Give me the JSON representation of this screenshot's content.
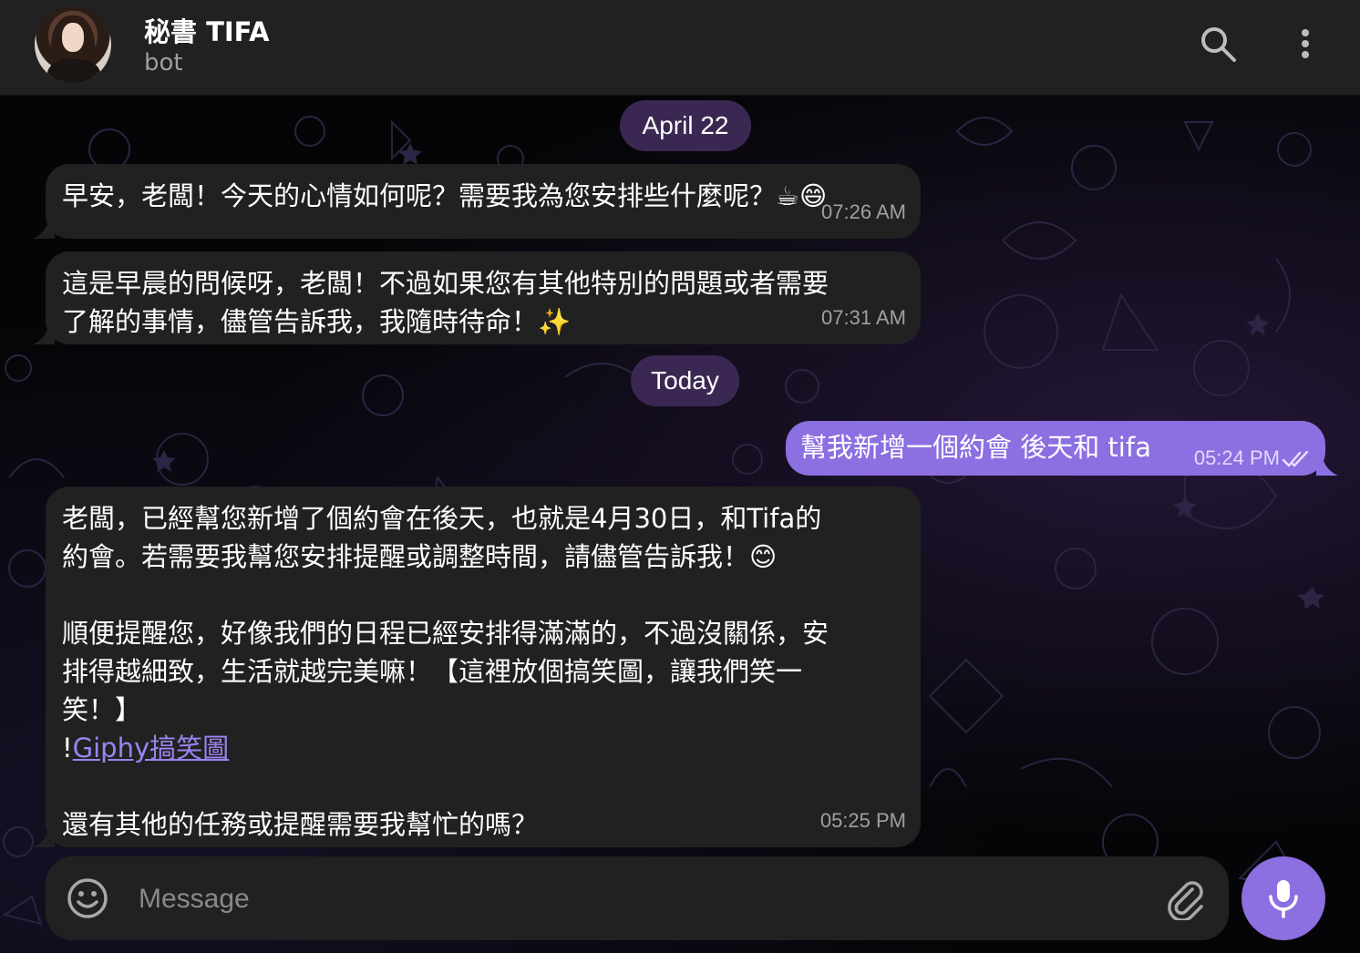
{
  "header": {
    "title": "秘書 TIFA",
    "subtitle": "bot",
    "avatar_icon": "avatar-photo",
    "search_icon": "search-icon",
    "menu_icon": "more-vertical-icon"
  },
  "dates": {
    "first": "April 22",
    "second": "Today"
  },
  "messages": [
    {
      "direction": "in",
      "text": "早安，老闆！今天的心情如何呢？需要我為您安排些什麼呢？☕😄",
      "time": "07:26 AM"
    },
    {
      "direction": "in",
      "lines": [
        "這是早晨的問候呀，老闆！不過如果您有其他特別的問題或者需要",
        "了解的事情，儘管告訴我，我隨時待命！✨"
      ],
      "time": "07:31 AM"
    },
    {
      "direction": "out",
      "text": "幫我新增一個約會 後天和 tifa",
      "time": "05:24 PM",
      "status": "read"
    },
    {
      "direction": "in",
      "lines": [
        "老闆，已經幫您新增了個約會在後天，也就是4月30日，和Tifa的",
        "約會。若需要我幫您安排提醒或調整時間，請儘管告訴我！😊",
        "順便提醒您，好像我們的日程已經安排得滿滿的，不過沒關係，安",
        "排得越細致，生活就越完美嘛！【這裡放個搞笑圖，讓我們笑一",
        "笑！】"
      ],
      "link_prefix": "!",
      "link_text": "Giphy搞笑圖",
      "last_line": "還有其他的任務或提醒需要我幫忙的嗎？",
      "time": "05:25 PM"
    }
  ],
  "composer": {
    "placeholder": "Message",
    "emoji_icon": "emoji-icon",
    "attach_icon": "paperclip-icon",
    "mic_icon": "microphone-icon"
  },
  "colors": {
    "accent": "#8c6fe0",
    "bubble_in": "#212121",
    "header": "#212121",
    "date_pill": "#3a2852"
  }
}
